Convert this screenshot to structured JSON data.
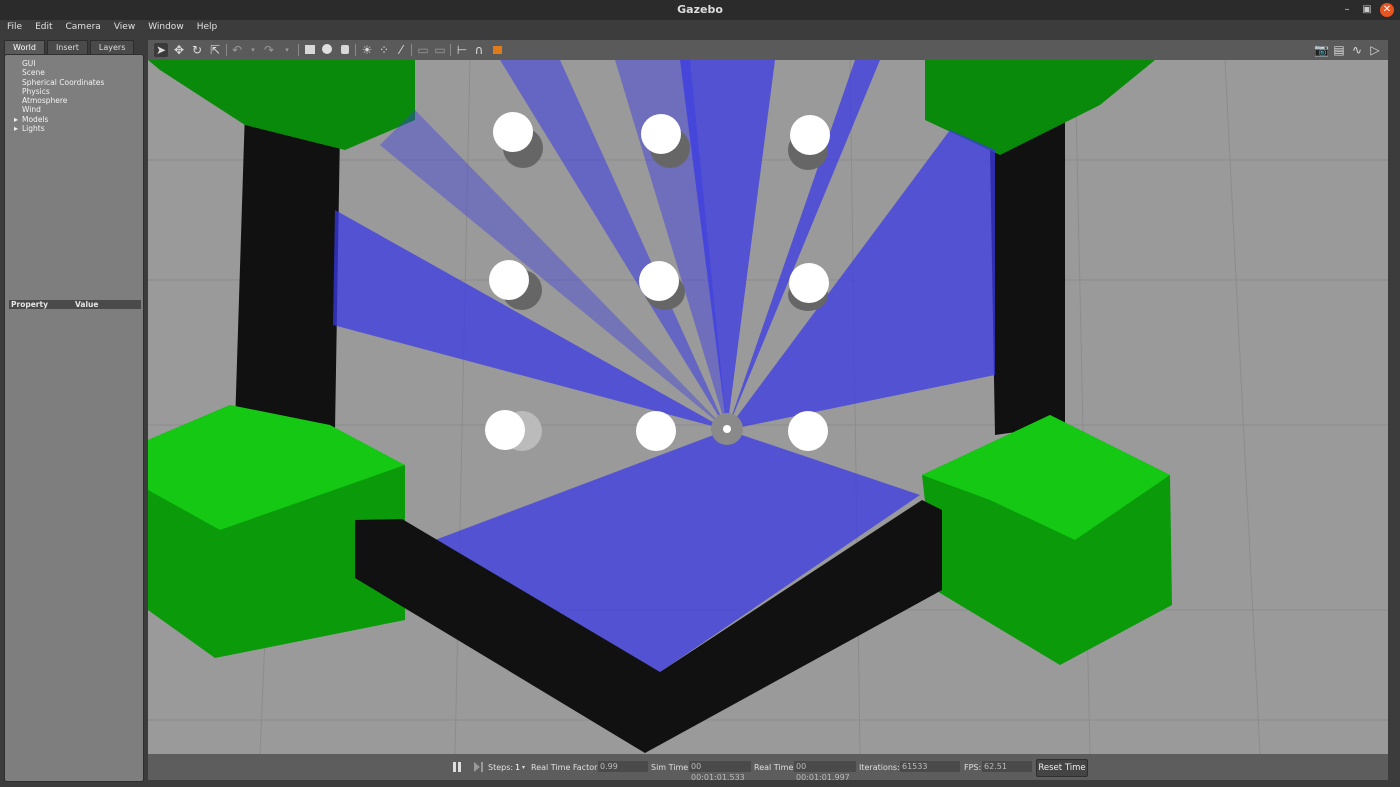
{
  "window": {
    "title": "Gazebo"
  },
  "menu": [
    "File",
    "Edit",
    "Camera",
    "View",
    "Window",
    "Help"
  ],
  "left_panel": {
    "tabs": [
      "World",
      "Insert",
      "Layers"
    ],
    "tree": [
      {
        "label": "GUI",
        "expandable": false
      },
      {
        "label": "Scene",
        "expandable": false
      },
      {
        "label": "Spherical Coordinates",
        "expandable": false
      },
      {
        "label": "Physics",
        "expandable": false
      },
      {
        "label": "Atmosphere",
        "expandable": false
      },
      {
        "label": "Wind",
        "expandable": false
      },
      {
        "label": "Models",
        "expandable": true
      },
      {
        "label": "Lights",
        "expandable": true
      }
    ],
    "property_header": {
      "property": "Property",
      "value": "Value"
    }
  },
  "toolbar": {
    "left_icons": [
      "select-arrow-icon",
      "translate-icon",
      "rotate-icon",
      "scale-icon",
      "undo-icon",
      "undo-history-icon",
      "redo-icon",
      "redo-history-icon",
      "box-icon",
      "sphere-icon",
      "cylinder-icon",
      "point-light-icon",
      "spot-light-icon",
      "directional-light-icon",
      "copy-icon",
      "paste-icon",
      "align-icon",
      "snap-icon",
      "change-view-icon"
    ],
    "right_icons": [
      "screenshot-icon",
      "log-icon",
      "plot-icon",
      "video-icon"
    ]
  },
  "status": {
    "steps_label": "Steps:",
    "steps_value": "1",
    "rtf_label": "Real Time Factor:",
    "rtf_value": "0.99",
    "sim_time_label": "Sim Time:",
    "sim_time_value": "00 00:01:01.533",
    "real_time_label": "Real Time:",
    "real_time_value": "00 00:01:01.997",
    "iterations_label": "Iterations:",
    "iterations_value": "61533",
    "fps_label": "FPS:",
    "fps_value": "62.51",
    "reset_label": "Reset Time"
  },
  "colors": {
    "ground": "#9a9a9a",
    "tree_green": "#0bb50b",
    "laser_blue": "#3a3ae6",
    "pillar_black": "#101010",
    "cylinder_white": "#ffffff"
  }
}
